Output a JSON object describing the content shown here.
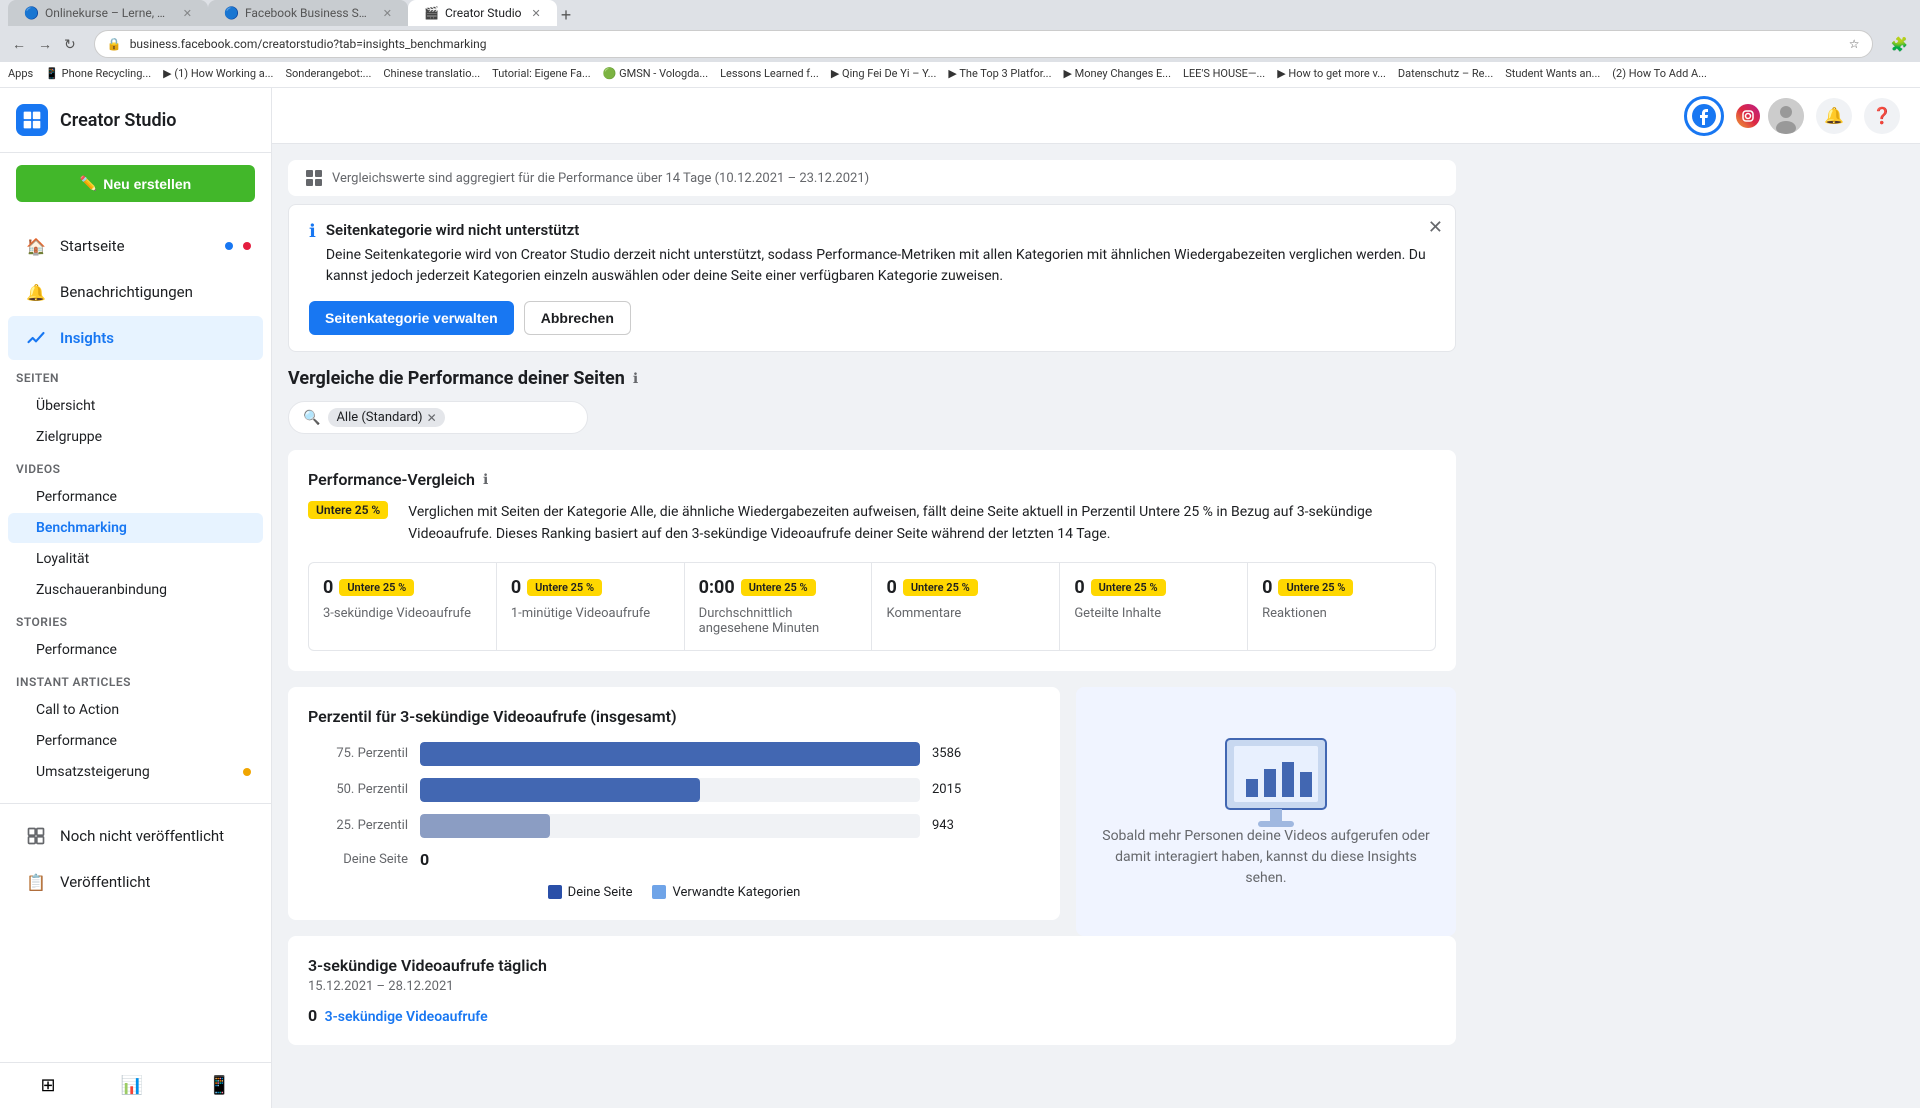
{
  "browser": {
    "url": "business.facebook.com/creatorstudio?tab=insights_benchmarking",
    "tabs": [
      {
        "id": "tab1",
        "label": "Onlinekurse – Lerne, was un...",
        "active": false,
        "favicon": "🟦"
      },
      {
        "id": "tab2",
        "label": "Facebook Business Suite",
        "active": false,
        "favicon": "🔵"
      },
      {
        "id": "tab3",
        "label": "Creator Studio",
        "active": true,
        "favicon": "🎬"
      }
    ]
  },
  "bookmarks": [
    "Apps",
    "Phone Recycling...",
    "(1) How Working a...",
    "Sonderangebot:...",
    "Chinese translatio...",
    "Tutorial: Eigene Fa...",
    "GMSN - Vologda...",
    "Lessons Learned f...",
    "Qing Fei De Yi – Y...",
    "The Top 3 Platfor...",
    "Money Changes E...",
    "LEE'S HOUSE—...",
    "How to get more v...",
    "Datenschutz – Re...",
    "Student Wants an...",
    "(2) How To Add A..."
  ],
  "sidebar": {
    "logo_text": "Creator Studio",
    "new_button_label": "Neu erstellen",
    "nav_items": [
      {
        "id": "startseite",
        "label": "Startseite",
        "has_dot": true
      },
      {
        "id": "benachrichtigungen",
        "label": "Benachrichtigungen",
        "has_dot": false
      },
      {
        "id": "insights",
        "label": "Insights",
        "active": true,
        "has_dot": false
      }
    ],
    "sections": [
      {
        "label": "Seiten",
        "items": [
          {
            "id": "ubersicht",
            "label": "Übersicht",
            "active": false
          },
          {
            "id": "zielgruppe",
            "label": "Zielgruppe",
            "active": false
          }
        ]
      },
      {
        "label": "Videos",
        "items": [
          {
            "id": "performance-videos",
            "label": "Performance",
            "active": false
          },
          {
            "id": "benchmarking",
            "label": "Benchmarking",
            "active": true
          },
          {
            "id": "loyalitat",
            "label": "Loyalität",
            "active": false
          },
          {
            "id": "zuschaueranbindung",
            "label": "Zuschaueranbindung",
            "active": false
          }
        ]
      },
      {
        "label": "Stories",
        "items": [
          {
            "id": "performance-stories",
            "label": "Performance",
            "active": false
          }
        ]
      },
      {
        "label": "Instant Articles",
        "items": [
          {
            "id": "call-to-action",
            "label": "Call to Action",
            "active": false
          },
          {
            "id": "performance-ia",
            "label": "Performance",
            "active": false
          },
          {
            "id": "umsatzsteigerung",
            "label": "Umsatzsteigerung",
            "active": false,
            "has_dot": true,
            "dot_color": "orange"
          }
        ]
      }
    ],
    "bottom_items": [
      {
        "id": "noch-nicht-veroffentlicht",
        "label": "Noch nicht veröffentlicht"
      },
      {
        "id": "veroffentlicht",
        "label": "Veröffentlicht"
      }
    ]
  },
  "topbar": {
    "facebook_active": true,
    "instagram_active": false
  },
  "main": {
    "info_bar_text": "Vergleichswerte sind aggregiert für die Performance über 14 Tage (10.12.2021 – 23.12.2021)",
    "warning": {
      "icon": "ℹ",
      "title": "Seitenkategorie wird nicht unterstützt",
      "body": "Deine Seitenkategorie wird von Creator Studio derzeit nicht unterstützt, sodass Performance-Metriken mit allen Kategorien mit ähnlichen Wiedergabezeiten verglichen werden. Du kannst jedoch jederzeit Kategorien einzeln auswählen oder deine Seite einer verfügbaren Kategorie zuweisen.",
      "btn_primary": "Seitenkategorie verwalten",
      "btn_secondary": "Abbrechen"
    },
    "compare_section": {
      "title": "Vergleiche die Performance deiner Seiten",
      "search_placeholder": "Alle (Standard)",
      "search_tag": "Alle (Standard)"
    },
    "perf_vergleich": {
      "title": "Performance-Vergleich",
      "badge": "Untere 25 %",
      "description": "Verglichen mit Seiten der Kategorie Alle, die ähnliche Wiedergabezeiten aufweisen, fällt deine Seite aktuell in Perzentil Untere 25 % in Bezug auf 3-sekündige Videoaufrufe. Dieses Ranking basiert auf den 3-sekündige Videoaufrufe deiner Seite während der letzten 14 Tage."
    },
    "metrics": [
      {
        "value": "0",
        "badge": "Untere 25 %",
        "label": "3-sekündige Videoaufrufe"
      },
      {
        "value": "0",
        "badge": "Untere 25 %",
        "label": "1-minütige Videoaufrufe"
      },
      {
        "value": "0:00",
        "badge": "Untere 25 %",
        "label": "Durchschnittlich angesehene Minuten"
      },
      {
        "value": "0",
        "badge": "Untere 25 %",
        "label": "Kommentare"
      },
      {
        "value": "0",
        "badge": "Untere 25 %",
        "label": "Geteilte Inhalte"
      },
      {
        "value": "0",
        "badge": "Untere 25 %",
        "label": "Reaktionen"
      }
    ],
    "percentile_section": {
      "title": "Perzentil für 3-sekündige Videoaufrufe (insgesamt)",
      "bars": [
        {
          "label": "75. Perzentil",
          "value": 3586,
          "width_pct": 100
        },
        {
          "label": "50. Perzentil",
          "value": 2015,
          "width_pct": 56
        },
        {
          "label": "25. Perzentil",
          "value": 943,
          "width_pct": 26
        }
      ],
      "deine_seite_label": "Deine Seite",
      "deine_seite_value": "0",
      "legend_deine": "Deine Seite",
      "legend_verwandte": "Verwandte Kategorien"
    },
    "insight_illustration": {
      "text": "Sobald mehr Personen deine Videos aufgerufen oder damit interagiert haben, kannst du diese Insights sehen."
    },
    "daily_section": {
      "title": "3-sekündige Videoaufrufe täglich",
      "date_range": "15.12.2021 – 28.12.2021",
      "value": "0",
      "link_text": "3-sekündige Videoaufrufe"
    }
  }
}
